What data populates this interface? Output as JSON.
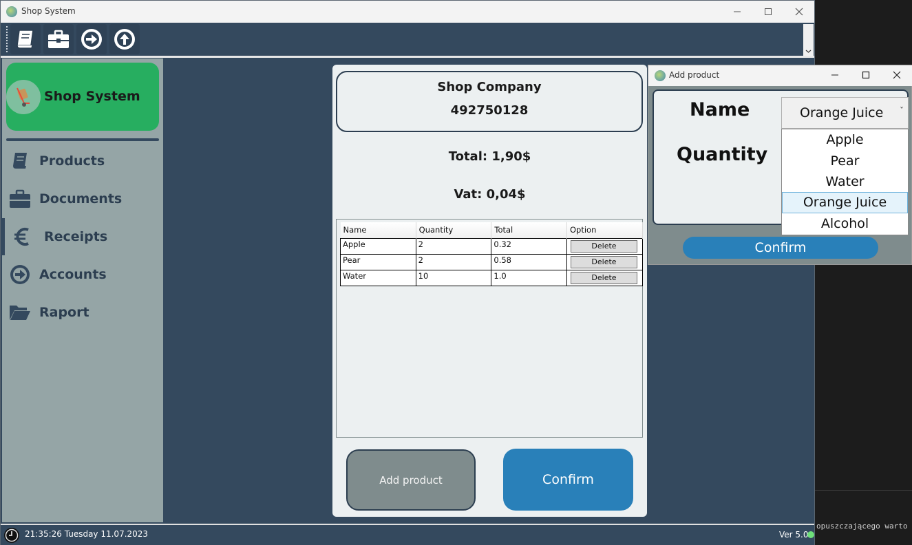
{
  "window": {
    "title": "Shop System"
  },
  "sidebar": {
    "brand": "Shop System",
    "items": [
      {
        "label": "Products",
        "icon": "book-icon"
      },
      {
        "label": "Documents",
        "icon": "briefcase-icon"
      },
      {
        "label": "Receipts",
        "icon": "euro-icon"
      },
      {
        "label": "Accounts",
        "icon": "arrow-right-circle-icon"
      },
      {
        "label": "Raport",
        "icon": "folder-open-icon"
      }
    ]
  },
  "toolbar": {
    "icons": [
      "book-icon",
      "briefcase-icon",
      "arrow-right-circle-icon",
      "arrow-up-circle-icon"
    ]
  },
  "receipt": {
    "company": "Shop Company",
    "number": "492750128",
    "total": "Total: 1,90$",
    "vat": "Vat: 0,04$",
    "table": {
      "headers": [
        "Name",
        "Quantity",
        "Total",
        "Option"
      ],
      "rows": [
        {
          "name": "Apple",
          "quantity": "2",
          "total": "0.32",
          "option": "Delete"
        },
        {
          "name": "Pear",
          "quantity": "2",
          "total": "0.58",
          "option": "Delete"
        },
        {
          "name": "Water",
          "quantity": "10",
          "total": "1.0",
          "option": "Delete"
        }
      ]
    },
    "add_product_label": "Add product",
    "confirm_label": "Confirm"
  },
  "status": {
    "datetime": "21:35:26 Tuesday 11.07.2023",
    "version": "Ver 5.0"
  },
  "dialog": {
    "title": "Add product",
    "name_label": "Name",
    "quantity_label": "Quantity",
    "selected": "Orange Juice",
    "options": [
      "Apple",
      "Pear",
      "Water",
      "Orange Juice",
      "Alcohol"
    ],
    "confirm_label": "Confirm"
  },
  "background_terminal": {
    "text": "opuszczającego warto"
  },
  "colors": {
    "dark_blue": "#34495e",
    "brand_green": "#27ae60",
    "accent_blue": "#2980b9",
    "sidebar_gray": "#95a5a6",
    "button_gray": "#7f8c8d",
    "panel_light": "#ecf0f1"
  }
}
